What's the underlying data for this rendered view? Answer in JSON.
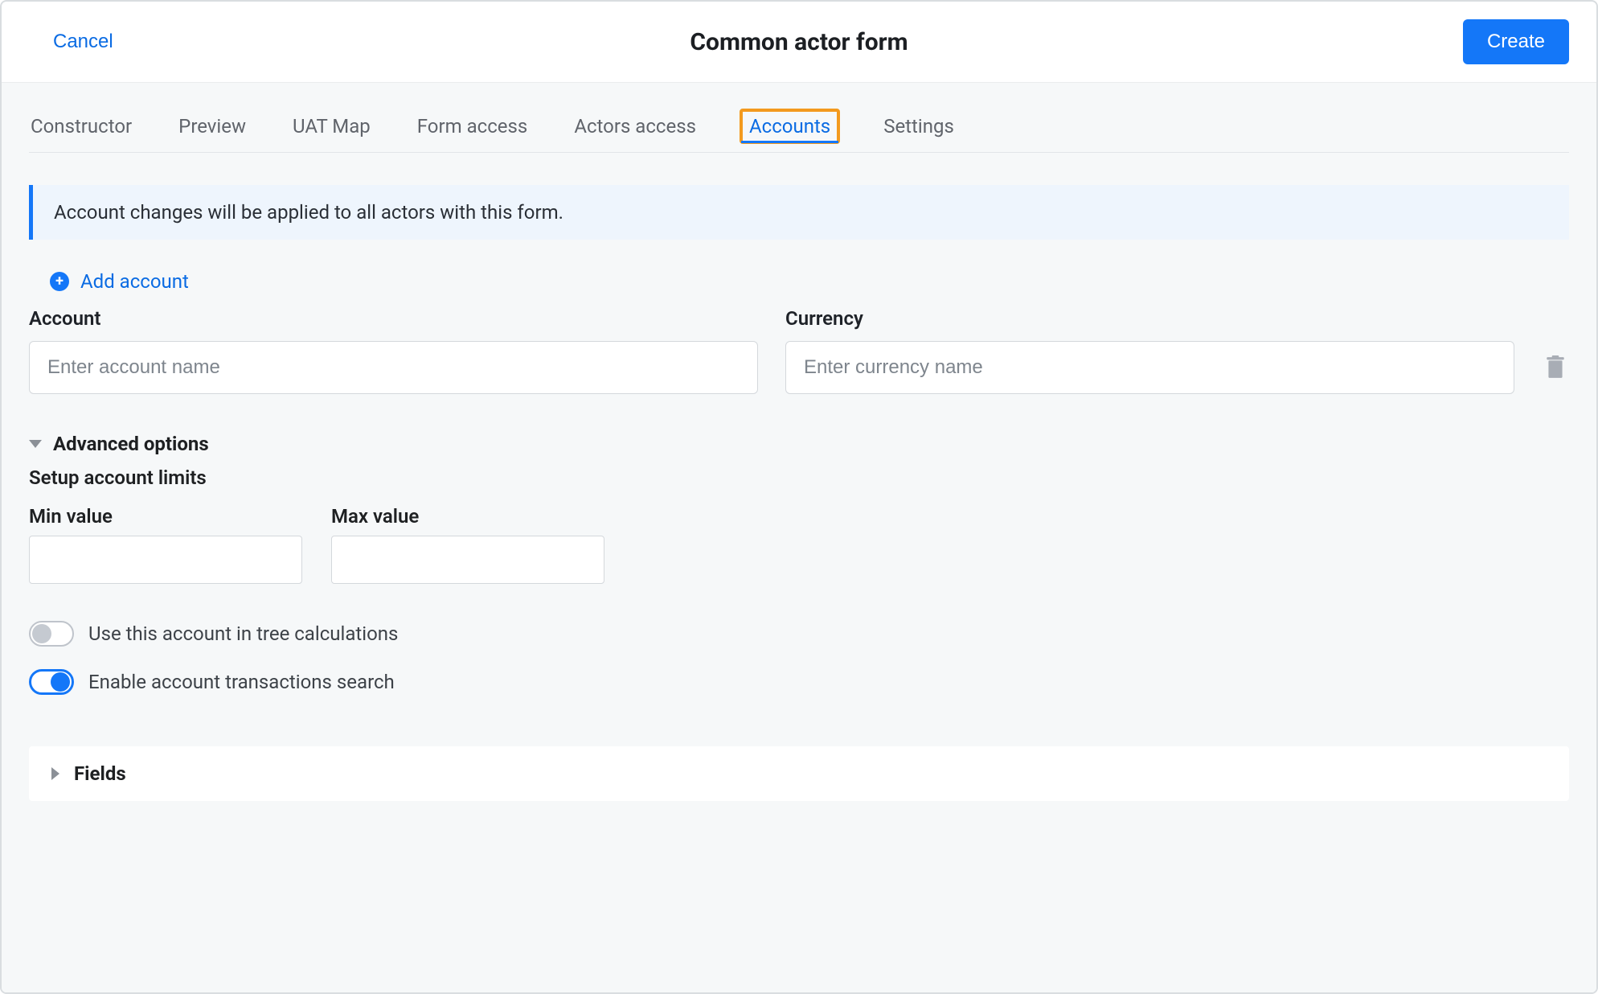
{
  "header": {
    "cancel": "Cancel",
    "title": "Common actor form",
    "create": "Create"
  },
  "tabs": [
    {
      "label": "Constructor",
      "active": false
    },
    {
      "label": "Preview",
      "active": false
    },
    {
      "label": "UAT Map",
      "active": false
    },
    {
      "label": "Form access",
      "active": false
    },
    {
      "label": "Actors access",
      "active": false
    },
    {
      "label": "Accounts",
      "active": true,
      "highlighted": true
    },
    {
      "label": "Settings",
      "active": false
    }
  ],
  "banner": "Account changes will be applied to all actors with this form.",
  "add_account_label": "Add account",
  "account_field": {
    "label": "Account",
    "placeholder": "Enter account name",
    "value": ""
  },
  "currency_field": {
    "label": "Currency",
    "placeholder": "Enter currency name",
    "value": ""
  },
  "advanced": {
    "title": "Advanced options",
    "limits_title": "Setup account limits",
    "min_label": "Min value",
    "min_value": "",
    "max_label": "Max value",
    "max_value": ""
  },
  "toggles": {
    "tree_calc": {
      "label": "Use this account in tree calculations",
      "on": false
    },
    "tx_search": {
      "label": "Enable account transactions search",
      "on": true
    }
  },
  "fields_section": "Fields",
  "colors": {
    "primary": "#1477f8",
    "highlight": "#f39a1e"
  }
}
